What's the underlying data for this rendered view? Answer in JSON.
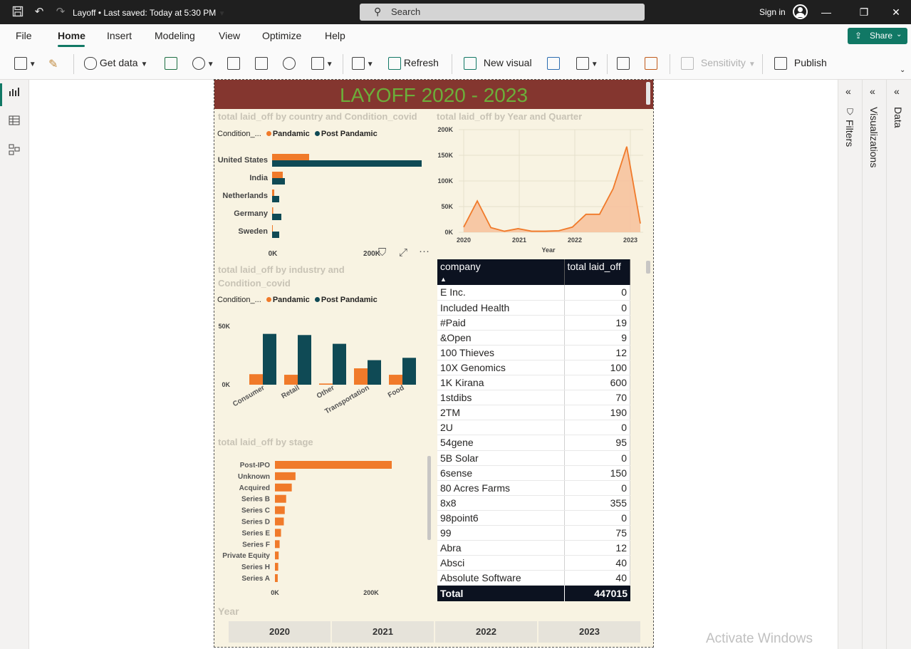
{
  "titlebar": {
    "file_name": "Layoff",
    "save_status": "Last saved: Today at 5:30 PM",
    "search_placeholder": "Search",
    "sign_in": "Sign in"
  },
  "menu": {
    "items": [
      "File",
      "Home",
      "Insert",
      "Modeling",
      "View",
      "Optimize",
      "Help"
    ],
    "active": "Home",
    "share_label": "Share"
  },
  "toolbar": {
    "get_data": "Get data",
    "refresh": "Refresh",
    "new_visual": "New visual",
    "sensitivity": "Sensitivity",
    "publish": "Publish"
  },
  "report": {
    "title": "LAYOFF 2020 - 2023",
    "country_title": "total laid_off by country and Condition_covid",
    "year_title": "total laid_off by Year and Quarter",
    "industry_title_1": "total laid_off by industry and",
    "industry_title_2": "Condition_covid",
    "stage_title": "total laid_off by stage",
    "legend_label": "Condition_...",
    "legend_pandemic": "Pandamic",
    "legend_post": "Post Pandamic",
    "slicer_label": "Year",
    "slicer_years": [
      "2020",
      "2021",
      "2022",
      "2023"
    ]
  },
  "colors": {
    "pandemic": "#f07a2a",
    "post_pandemic": "#0f4a55",
    "title_bg": "#84362f",
    "title_fg": "#6cae3a",
    "area_fill": "#f7c09a",
    "area_line": "#f07a2a"
  },
  "chart_data": [
    {
      "type": "bar",
      "orientation": "horizontal",
      "title": "total laid_off by country and Condition_covid",
      "categories": [
        "United States",
        "India",
        "Netherlands",
        "Germany",
        "Sweden"
      ],
      "series": [
        {
          "name": "Pandamic",
          "values": [
            52000,
            15000,
            3000,
            1500,
            1000
          ]
        },
        {
          "name": "Post Pandamic",
          "values": [
            210000,
            18000,
            10000,
            13000,
            10000
          ]
        }
      ],
      "xticks": [
        "0K",
        "200K"
      ],
      "xlim": [
        0,
        250000
      ]
    },
    {
      "type": "area",
      "title": "total laid_off by Year and Quarter",
      "xlabel": "Year",
      "x_ticks": [
        "2020",
        "2021",
        "2022",
        "2023"
      ],
      "y_ticks": [
        "0K",
        "50K",
        "100K",
        "150K",
        "200K"
      ],
      "ylim": [
        0,
        200000
      ],
      "values": [
        10000,
        61000,
        9000,
        2000,
        7000,
        2000,
        2000,
        3000,
        10000,
        35000,
        35000,
        85000,
        167000,
        17000
      ]
    },
    {
      "type": "bar",
      "orientation": "vertical",
      "title": "total laid_off by industry and Condition_covid",
      "categories": [
        "Consumer",
        "Retail",
        "Other",
        "Transportation",
        "Food"
      ],
      "series": [
        {
          "name": "Pandamic",
          "values": [
            9000,
            8500,
            1000,
            14000,
            8500
          ]
        },
        {
          "name": "Post Pandamic",
          "values": [
            43500,
            42500,
            35000,
            21000,
            23000
          ]
        }
      ],
      "y_ticks": [
        "0K",
        "50K"
      ],
      "ylim": [
        0,
        50000
      ]
    },
    {
      "type": "bar",
      "orientation": "horizontal",
      "title": "total laid_off by stage",
      "categories": [
        "Post-IPO",
        "Unknown",
        "Acquired",
        "Series B",
        "Series C",
        "Series D",
        "Series E",
        "Series F",
        "Private Equity",
        "Series H",
        "Series A"
      ],
      "values": [
        250000,
        44000,
        36000,
        24000,
        21000,
        19000,
        13000,
        10000,
        8000,
        7000,
        6000
      ],
      "xticks": [
        "0K",
        "200K"
      ],
      "xlim": [
        0,
        300000
      ]
    }
  ],
  "table": {
    "headers": [
      "company",
      "total laid_off"
    ],
    "rows": [
      [
        "E Inc.",
        "0"
      ],
      [
        "Included Health",
        "0"
      ],
      [
        "#Paid",
        "19"
      ],
      [
        "&Open",
        "9"
      ],
      [
        "100 Thieves",
        "12"
      ],
      [
        "10X Genomics",
        "100"
      ],
      [
        "1K Kirana",
        "600"
      ],
      [
        "1stdibs",
        "70"
      ],
      [
        "2TM",
        "190"
      ],
      [
        "2U",
        "0"
      ],
      [
        "54gene",
        "95"
      ],
      [
        "5B Solar",
        "0"
      ],
      [
        "6sense",
        "150"
      ],
      [
        "80 Acres Farms",
        "0"
      ],
      [
        "8x8",
        "355"
      ],
      [
        "98point6",
        "0"
      ],
      [
        "99",
        "75"
      ],
      [
        "Abra",
        "12"
      ],
      [
        "Absci",
        "40"
      ],
      [
        "Absolute Software",
        "40"
      ]
    ],
    "total_label": "Total",
    "total_value": "447015"
  },
  "panes": {
    "filters": "Filters",
    "visualizations": "Visualizations",
    "data": "Data"
  },
  "watermark": "Activate Windows"
}
